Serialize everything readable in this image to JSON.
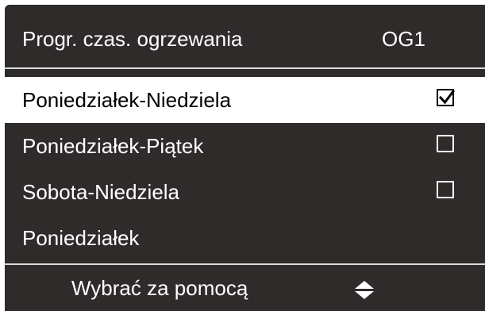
{
  "header": {
    "title": "Progr. czas. ogrzewania",
    "circuit": "OG1"
  },
  "options": [
    {
      "label": "Poniedziałek-Niedziela",
      "checked": true,
      "selected": true
    },
    {
      "label": "Poniedziałek-Piątek",
      "checked": false,
      "selected": false
    },
    {
      "label": "Sobota-Niedziela",
      "checked": false,
      "selected": false
    },
    {
      "label": "Poniedziałek",
      "checked": null,
      "selected": false
    }
  ],
  "footer": {
    "hint": "Wybrać za pomocą",
    "icon": "up-down-arrows-icon"
  },
  "colors": {
    "panel_bg": "#2f2b2a",
    "text_on_panel": "#ffffff",
    "selected_bg": "#ffffff",
    "selected_text": "#000000"
  }
}
